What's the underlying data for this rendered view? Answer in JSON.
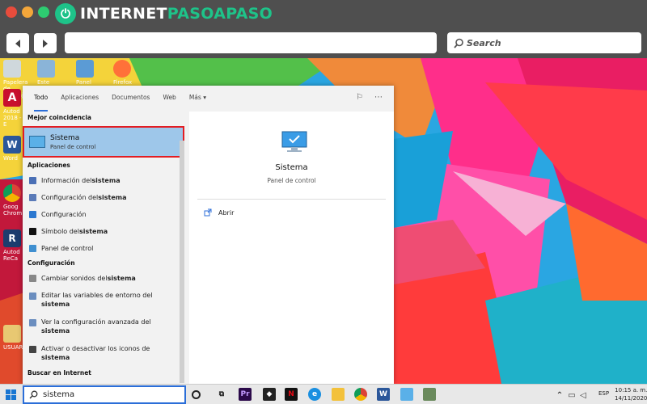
{
  "browser": {
    "logo_prefix": "INTERNET",
    "logo_accent": "PASOAPASO",
    "search_label": "Search",
    "colors": {
      "close": "#e74c3c",
      "minimize": "#f3a63a",
      "maximize": "#2ecc71",
      "brand": "#1ec389"
    }
  },
  "desktop": {
    "icons": [
      {
        "label": "Papelera de reciclaje",
        "icon": "recycle-bin-icon"
      },
      {
        "label": "Este equipo",
        "icon": "computer-icon"
      },
      {
        "label": "Panel de control",
        "icon": "control-panel-icon"
      },
      {
        "label": "Firefox",
        "icon": "firefox-icon"
      },
      {
        "label": "Autod 2018 - E",
        "icon": "autodesk-icon"
      },
      {
        "label": "Word",
        "icon": "word-icon"
      },
      {
        "label": "Goog Chrom",
        "icon": "chrome-icon"
      },
      {
        "label": "Autod ReCa",
        "icon": "recap-icon"
      },
      {
        "label": "USUAR",
        "icon": "user-folder-icon"
      }
    ]
  },
  "start": {
    "tabs": [
      "Todo",
      "Aplicaciones",
      "Documentos",
      "Web",
      "Más"
    ],
    "best_match_header": "Mejor coincidencia",
    "best_match": {
      "title": "Sistema",
      "subtitle": "Panel de control"
    },
    "apps_header": "Aplicaciones",
    "apps": [
      {
        "text": "Información del ",
        "bold": "sistema"
      },
      {
        "text": "Configuración del ",
        "bold": "sistema"
      },
      {
        "text": "Configuración",
        "bold": ""
      },
      {
        "text": "Símbolo del ",
        "bold": "sistema"
      },
      {
        "text": "Panel de control",
        "bold": ""
      }
    ],
    "settings_header": "Configuración",
    "settings": [
      {
        "text": "Cambiar sonidos del ",
        "bold": "sistema"
      },
      {
        "text": "Editar las variables de entorno del ",
        "bold": "sistema"
      },
      {
        "text": "Ver la configuración avanzada del ",
        "bold": "sistema"
      },
      {
        "text": "Activar o desactivar los iconos de ",
        "bold": "sistema"
      }
    ],
    "web_header": "Buscar en Internet",
    "preview": {
      "title": "Sistema",
      "subtitle": "Panel de control",
      "action": "Abrir"
    }
  },
  "taskbar": {
    "search_value": "sistema",
    "time": "10:15 a. m.",
    "date": "14/11/2020",
    "lang": "ESP"
  }
}
